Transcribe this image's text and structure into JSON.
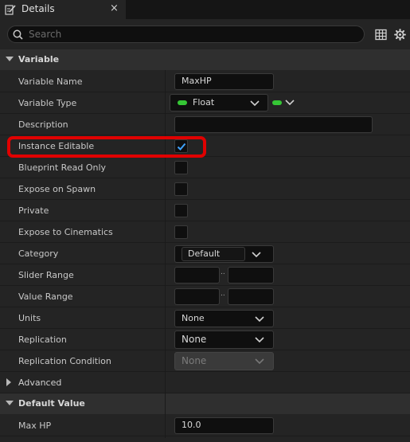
{
  "tab": {
    "title": "Details",
    "close": "×"
  },
  "search": {
    "placeholder": "Search",
    "value": ""
  },
  "icons": {
    "tab": "pencil-document-icon",
    "search": "search-icon",
    "table": "table-view-icon",
    "settings": "gear-icon",
    "chevron": "chevron-down-icon",
    "check": "checkmark-icon"
  },
  "sections": {
    "variable": "Variable",
    "advanced": "Advanced",
    "default_value": "Default Value"
  },
  "properties": {
    "variable_name": {
      "label": "Variable Name",
      "value": "MaxHP"
    },
    "variable_type": {
      "label": "Variable Type",
      "value": "Float"
    },
    "description": {
      "label": "Description",
      "value": ""
    },
    "instance_editable": {
      "label": "Instance Editable",
      "checked": true
    },
    "blueprint_read_only": {
      "label": "Blueprint Read Only",
      "checked": false
    },
    "expose_on_spawn": {
      "label": "Expose on Spawn",
      "checked": false
    },
    "private": {
      "label": "Private",
      "checked": false
    },
    "expose_to_cinematics": {
      "label": "Expose to Cinematics",
      "checked": false
    },
    "category": {
      "label": "Category",
      "value": "Default"
    },
    "slider_range": {
      "label": "Slider Range",
      "min": "",
      "max": "",
      "separator": ".."
    },
    "value_range": {
      "label": "Value Range",
      "min": "",
      "max": "",
      "separator": ".."
    },
    "units": {
      "label": "Units",
      "value": "None"
    },
    "replication": {
      "label": "Replication",
      "value": "None"
    },
    "replication_condition": {
      "label": "Replication Condition",
      "value": "None"
    },
    "max_hp": {
      "label": "Max HP",
      "value": "10.0"
    }
  },
  "colors": {
    "accent_blue": "#3fa3ff",
    "pin_float_green": "#35c635",
    "highlight_red": "#e00000"
  }
}
